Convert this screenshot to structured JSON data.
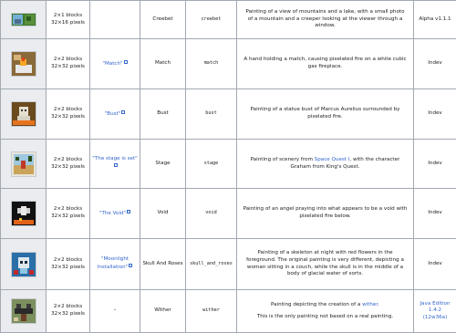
{
  "rows": [
    {
      "dims": "2×1 blocks",
      "px": "32×16 pixels",
      "title": "",
      "name": "Creebet",
      "id": "creebet",
      "desc": "Painting of a view of mountains and a lake, with a small photo of a mountain and a creeper looking at the viewer through a window.",
      "version": "Alpha v1.1.1",
      "img": "creebet-painting"
    },
    {
      "dims": "2×2 blocks",
      "px": "32×32 pixels",
      "title": "\"Match\"",
      "name": "Match",
      "id": "match",
      "desc": "A hand holding a match, causing pixelated fire on a white cubic gas fireplace.",
      "version": "Indev",
      "img": "match-painting"
    },
    {
      "dims": "2×2 blocks",
      "px": "32×32 pixels",
      "title": "\"Bust\"",
      "name": "Bust",
      "id": "bust",
      "desc": "Painting of a statue bust of Marcus Aurelius surrounded by pixelated fire.",
      "version": "Indev",
      "img": "bust-painting"
    },
    {
      "dims": "2×2 blocks",
      "px": "32×32 pixels",
      "title": "\"The stage is set\"",
      "name": "Stage",
      "id": "stage",
      "desc_pre": "Painting of scenery from ",
      "desc_link": "Space Quest I",
      "desc_post": ", with the character Graham from King's Quest.",
      "version": "Indev",
      "img": "stage-painting"
    },
    {
      "dims": "2×2 blocks",
      "px": "32×32 pixels",
      "title": "\"The Void\"",
      "name": "Void",
      "id": "void",
      "desc": "Painting of an angel praying into what appears to be a void with pixelated fire below.",
      "version": "Indev",
      "img": "void-painting"
    },
    {
      "dims": "2×2 blocks",
      "px": "32×32 pixels",
      "title": "\"Moonlight Installation\"",
      "name": "Skull And Roses",
      "id": "skull_and_roses",
      "desc": "Painting of a skeleton at night with red flowers in the foreground. The original painting is very different, depicting a woman sitting in a couch, while the skull is in the middle of a body of glacial water of sorts.",
      "version": "Indev",
      "img": "skull-and-roses-painting"
    },
    {
      "dims": "2×2 blocks",
      "px": "32×32 pixels",
      "title": "–",
      "name": "Wither",
      "id": "wither",
      "desc_pre": "Painting depicting the creation of a ",
      "desc_link": "wither",
      "desc_post": ".",
      "desc2": "This is the only painting not based on a real painting.",
      "version": "Java Edition 1.4.2 (12w36a)",
      "img": "wither-painting"
    }
  ]
}
